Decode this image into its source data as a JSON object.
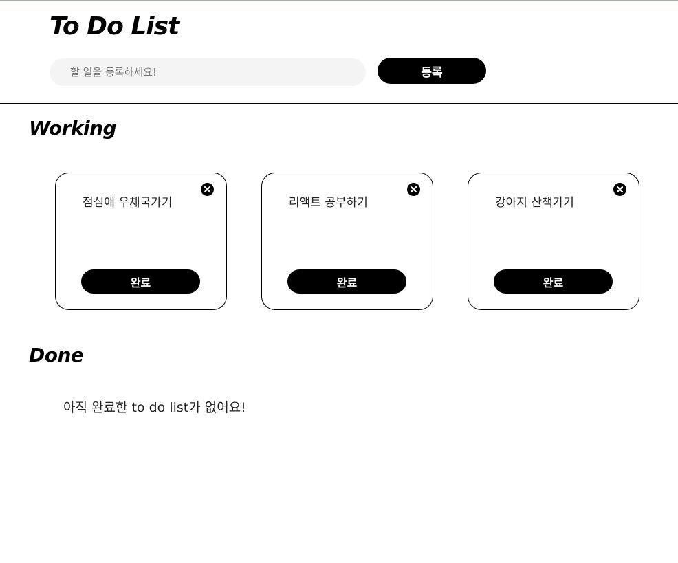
{
  "header": {
    "title": "To Do List",
    "input_placeholder": "할 일을 등록하세요!",
    "input_value": "",
    "add_label": "등록"
  },
  "working": {
    "title": "Working",
    "items": [
      {
        "text": "점심에 우체국가기",
        "complete_label": "완료",
        "delete_icon": "close-circle-icon"
      },
      {
        "text": "리액트 공부하기",
        "complete_label": "완료",
        "delete_icon": "close-circle-icon"
      },
      {
        "text": "강아지 산책가기",
        "complete_label": "완료",
        "delete_icon": "close-circle-icon"
      }
    ]
  },
  "done": {
    "title": "Done",
    "empty_message": "아직 완료한 to do list가 없어요!"
  },
  "colors": {
    "accent": "#000000",
    "input_background": "#f4f4f4",
    "background": "#ffffff"
  }
}
